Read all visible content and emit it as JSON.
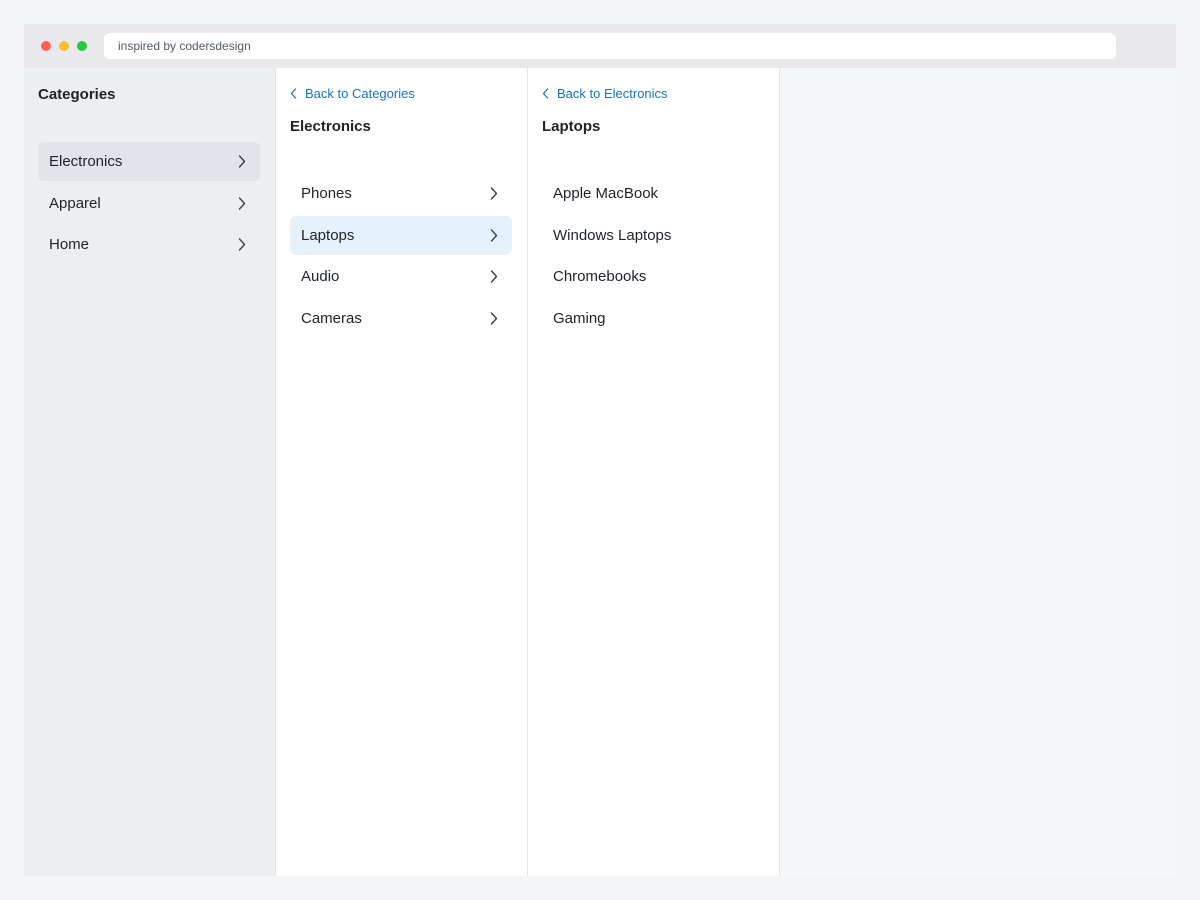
{
  "browser": {
    "address": "inspired by codersdesign"
  },
  "columns": {
    "root": {
      "title": "Categories",
      "items": [
        {
          "label": "Electronics"
        },
        {
          "label": "Apparel"
        },
        {
          "label": "Home"
        }
      ]
    },
    "electronics": {
      "back_label": "Back to Categories",
      "title": "Electronics",
      "items": [
        {
          "label": "Phones"
        },
        {
          "label": "Laptops"
        },
        {
          "label": "Audio"
        },
        {
          "label": "Cameras"
        }
      ]
    },
    "laptops": {
      "back_label": "Back to Electronics",
      "title": "Laptops",
      "items": [
        {
          "label": "Apple MacBook"
        },
        {
          "label": "Windows Laptops"
        },
        {
          "label": "Chromebooks"
        },
        {
          "label": "Gaming"
        }
      ]
    }
  },
  "selection": {
    "root": "Electronics",
    "electronics": "Laptops"
  },
  "colors": {
    "accent": "#1a73b8",
    "active_root_bg": "#e1e4e8",
    "active_sub_bg": "#e6f2fb"
  },
  "icons": {
    "item_chevron": "chevron-right-icon",
    "back_chevron": "chevron-left-icon"
  }
}
